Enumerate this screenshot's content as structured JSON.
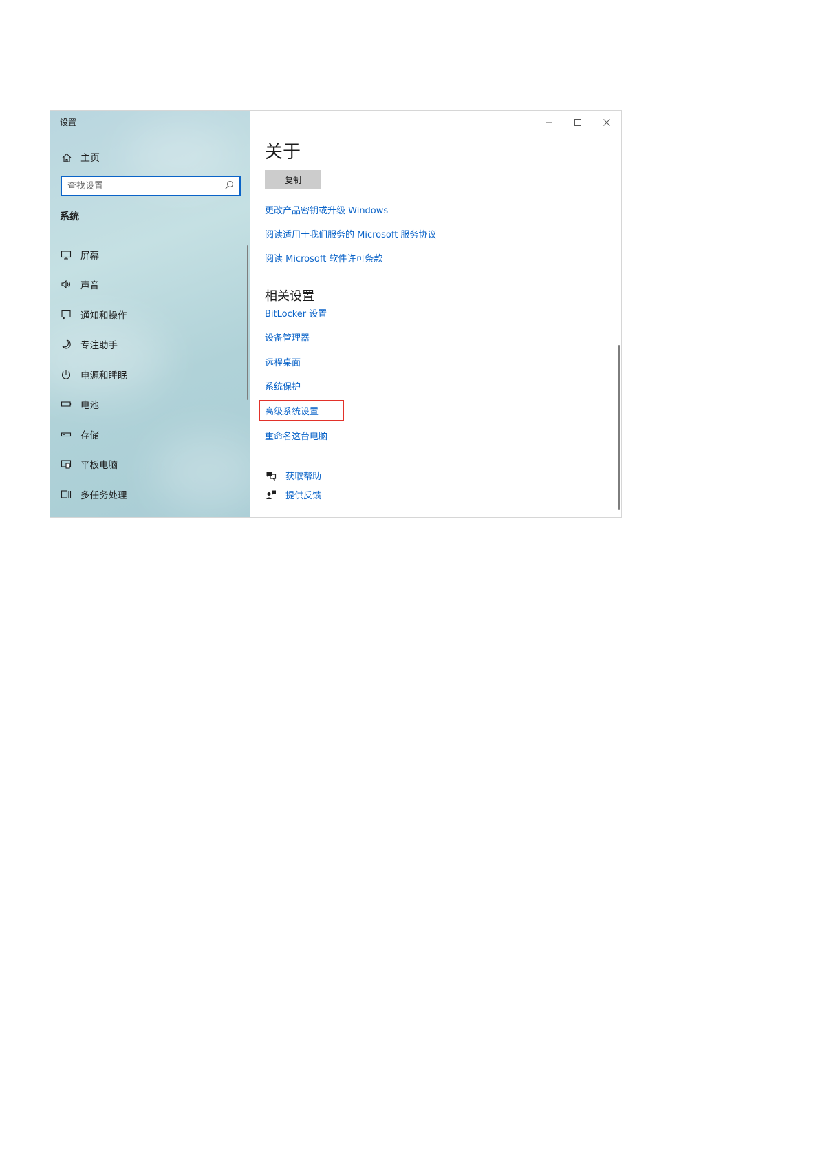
{
  "window": {
    "title": "设置"
  },
  "sidebar": {
    "home": {
      "label": "主页",
      "icon": "home-icon"
    },
    "search": {
      "placeholder": "查找设置",
      "value": "",
      "icon": "search-icon"
    },
    "section": "系统",
    "items": [
      {
        "label": "屏幕",
        "icon": "monitor-icon"
      },
      {
        "label": "声音",
        "icon": "speaker-icon"
      },
      {
        "label": "通知和操作",
        "icon": "notification-icon"
      },
      {
        "label": "专注助手",
        "icon": "moon-icon"
      },
      {
        "label": "电源和睡眠",
        "icon": "power-icon"
      },
      {
        "label": "电池",
        "icon": "battery-icon"
      },
      {
        "label": "存储",
        "icon": "storage-icon"
      },
      {
        "label": "平板电脑",
        "icon": "tablet-icon"
      },
      {
        "label": "多任务处理",
        "icon": "multitask-icon"
      }
    ]
  },
  "controls": {
    "minimize": "minimize-icon",
    "maximize": "maximize-icon",
    "close": "close-icon"
  },
  "main": {
    "title": "关于",
    "copy_button": "复制",
    "links": [
      "更改产品密钥或升级 Windows",
      "阅读适用于我们服务的 Microsoft 服务协议",
      "阅读 Microsoft 软件许可条款"
    ],
    "related_title": "相关设置",
    "related_links": [
      "BitLocker 设置",
      "设备管理器",
      "远程桌面",
      "系统保护",
      "高级系统设置",
      "重命名这台电脑"
    ],
    "help": [
      {
        "label": "获取帮助",
        "icon": "help-chat-icon"
      },
      {
        "label": "提供反馈",
        "icon": "feedback-icon"
      }
    ],
    "highlight_color": "#e2322a",
    "link_color": "#0a63c8"
  }
}
